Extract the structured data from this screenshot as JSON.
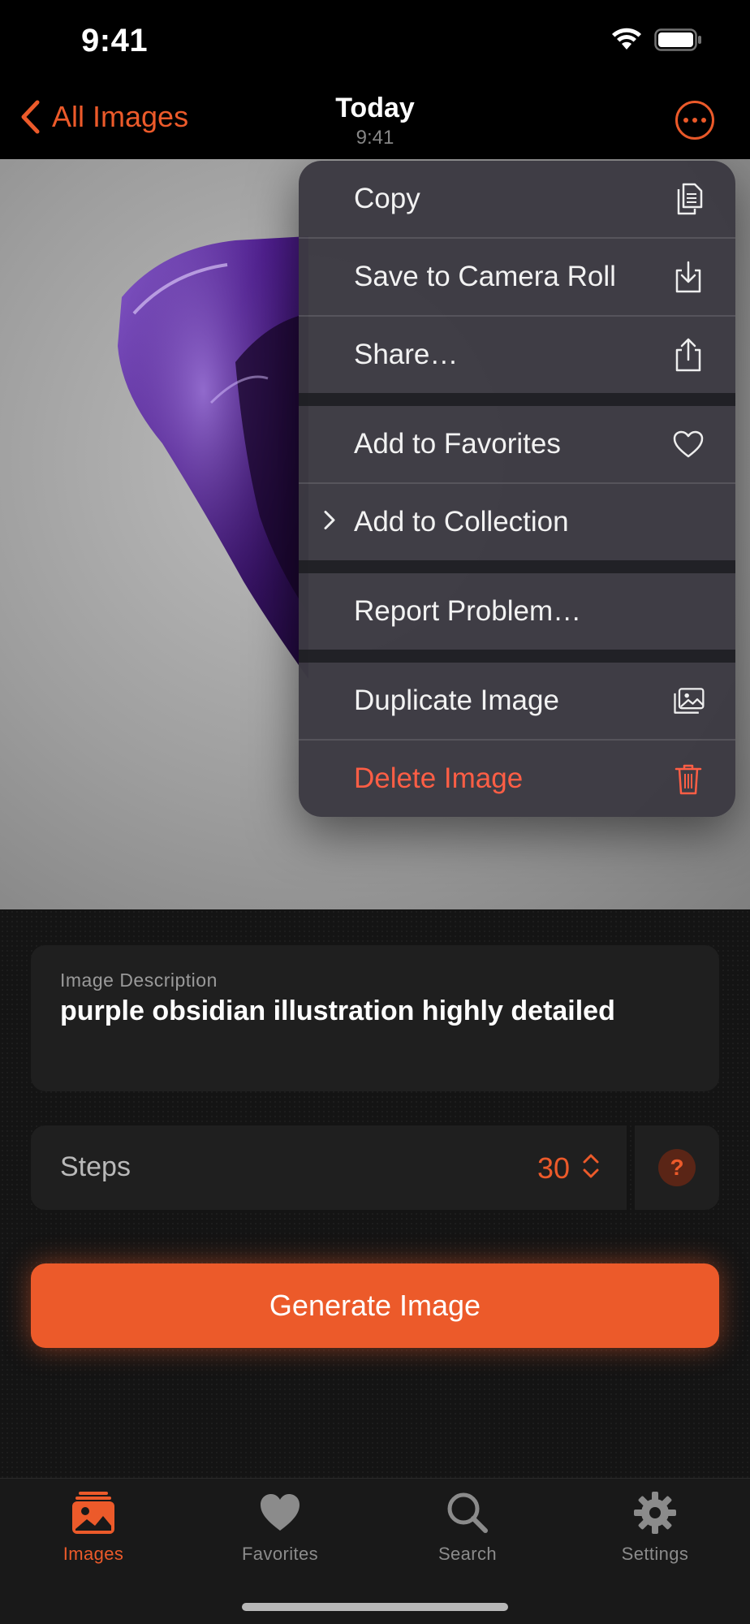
{
  "status_bar": {
    "time": "9:41"
  },
  "nav": {
    "back_label": "All Images",
    "title": "Today",
    "subtitle": "9:41"
  },
  "menu": {
    "items": [
      {
        "label": "Copy",
        "icon": "copy-icon"
      },
      {
        "label": "Save to Camera Roll",
        "icon": "save-download-icon"
      },
      {
        "label": "Share…",
        "icon": "share-icon"
      },
      {
        "label": "Add to Favorites",
        "icon": "heart-outline-icon"
      },
      {
        "label": "Add to Collection",
        "icon": "chevron-right-icon"
      },
      {
        "label": "Report Problem…",
        "icon": ""
      },
      {
        "label": "Duplicate Image",
        "icon": "duplicate-photos-icon"
      },
      {
        "label": "Delete Image",
        "icon": "trash-icon",
        "destructive": true
      }
    ]
  },
  "description": {
    "label": "Image Description",
    "text": "purple obsidian illustration highly detailed"
  },
  "steps": {
    "label": "Steps",
    "value": "30",
    "help": "?"
  },
  "generate": {
    "label": "Generate Image"
  },
  "tabs": [
    {
      "label": "Images",
      "icon": "images-icon",
      "active": true
    },
    {
      "label": "Favorites",
      "icon": "heart-icon",
      "active": false
    },
    {
      "label": "Search",
      "icon": "search-icon",
      "active": false
    },
    {
      "label": "Settings",
      "icon": "gear-icon",
      "active": false
    }
  ],
  "colors": {
    "accent": "#ec5a2a",
    "destructive": "#ff5e45",
    "background": "#000000"
  }
}
